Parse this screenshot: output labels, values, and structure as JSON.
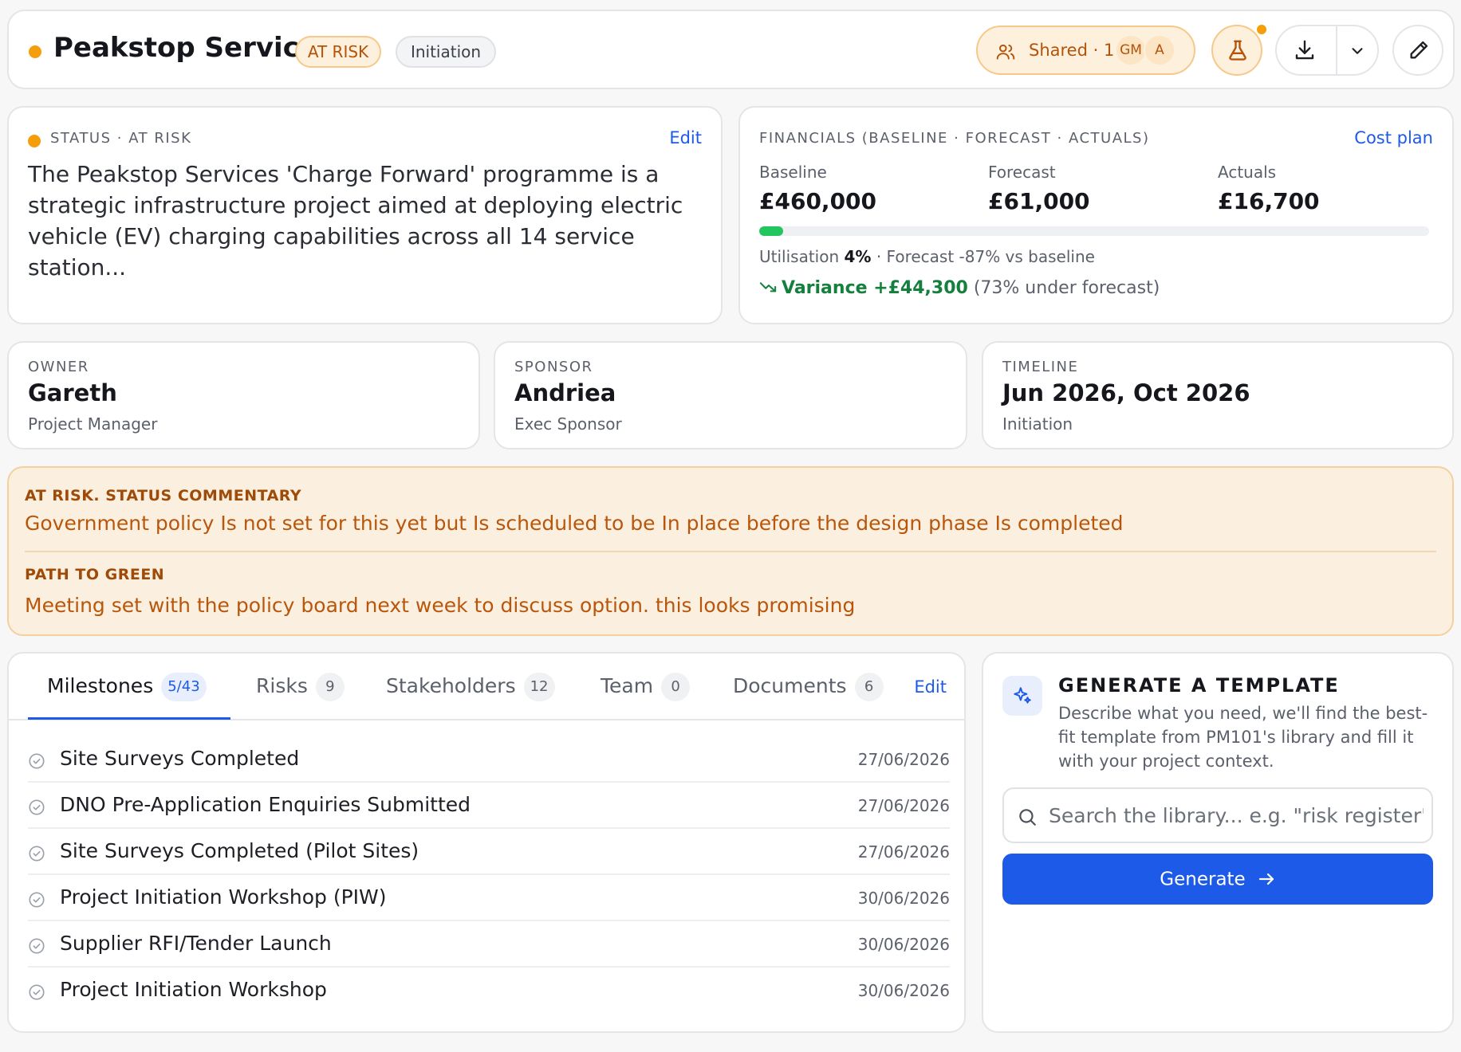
{
  "header": {
    "title": "Peakstop Services",
    "risk_pill": "AT RISK",
    "phase_pill": "Initiation",
    "shared_label": "Shared · 1",
    "avatars": [
      "GM",
      "A"
    ],
    "status_color": "#f59e0b"
  },
  "status": {
    "label": "STATUS · AT RISK",
    "edit_label": "Edit",
    "description": "The Peakstop Services 'Charge Forward' programme is a strategic infrastructure project aimed at deploying electric vehicle (EV) charging capabilities across all 14 service station..."
  },
  "financials": {
    "label": "FINANCIALS (BASELINE · FORECAST · ACTUALS)",
    "link_label": "Cost plan",
    "baseline_label": "Baseline",
    "baseline_value": "£460,000",
    "forecast_label": "Forecast",
    "forecast_value": "£61,000",
    "actuals_label": "Actuals",
    "actuals_value": "£16,700",
    "utilisation_prefix": "Utilisation",
    "utilisation_value": "4%",
    "utilisation_fraction": 0.036,
    "forecast_note": "· Forecast -87% vs baseline",
    "variance_text": "Variance +£44,300",
    "variance_note": "(73% under forecast)",
    "accent_green": "#15803d"
  },
  "people": {
    "owner_label": "OWNER",
    "owner_name": "Gareth",
    "owner_role": "Project Manager",
    "sponsor_label": "SPONSOR",
    "sponsor_name": "Andriea",
    "sponsor_role": "Exec Sponsor",
    "timeline_label": "TIMELINE",
    "timeline_value": "Jun 2026, Oct 2026",
    "timeline_phase": "Initiation"
  },
  "commentary": {
    "heading": "AT RISK. STATUS COMMENTARY",
    "text": "Government policy Is not set for this yet but Is scheduled to be In place before the design phase Is completed",
    "path_heading": "PATH TO GREEN",
    "path_text": "Meeting set with the policy board next week to discuss option. this looks promising"
  },
  "tabs": [
    {
      "label": "Milestones",
      "count": "5/43"
    },
    {
      "label": "Risks",
      "count": "9"
    },
    {
      "label": "Stakeholders",
      "count": "12"
    },
    {
      "label": "Team",
      "count": "0"
    },
    {
      "label": "Documents",
      "count": "6"
    }
  ],
  "tabs_edit_label": "Edit",
  "milestones": [
    {
      "name": "Site Surveys Completed",
      "date": "27/06/2026"
    },
    {
      "name": "DNO Pre-Application Enquiries Submitted",
      "date": "27/06/2026"
    },
    {
      "name": "Site Surveys Completed (Pilot Sites)",
      "date": "27/06/2026"
    },
    {
      "name": "Project Initiation Workshop (PIW)",
      "date": "30/06/2026"
    },
    {
      "name": "Supplier RFI/Tender Launch",
      "date": "30/06/2026"
    },
    {
      "name": "Project Initiation Workshop",
      "date": "30/06/2026"
    }
  ],
  "generator": {
    "title": "GENERATE A TEMPLATE",
    "description": "Describe what you need, we'll find the best-fit template from PM101's library and fill it with your project context.",
    "placeholder": "Search the library... e.g. \"risk register\"",
    "button_label": "Generate",
    "accent_blue": "#1d5ae8"
  }
}
